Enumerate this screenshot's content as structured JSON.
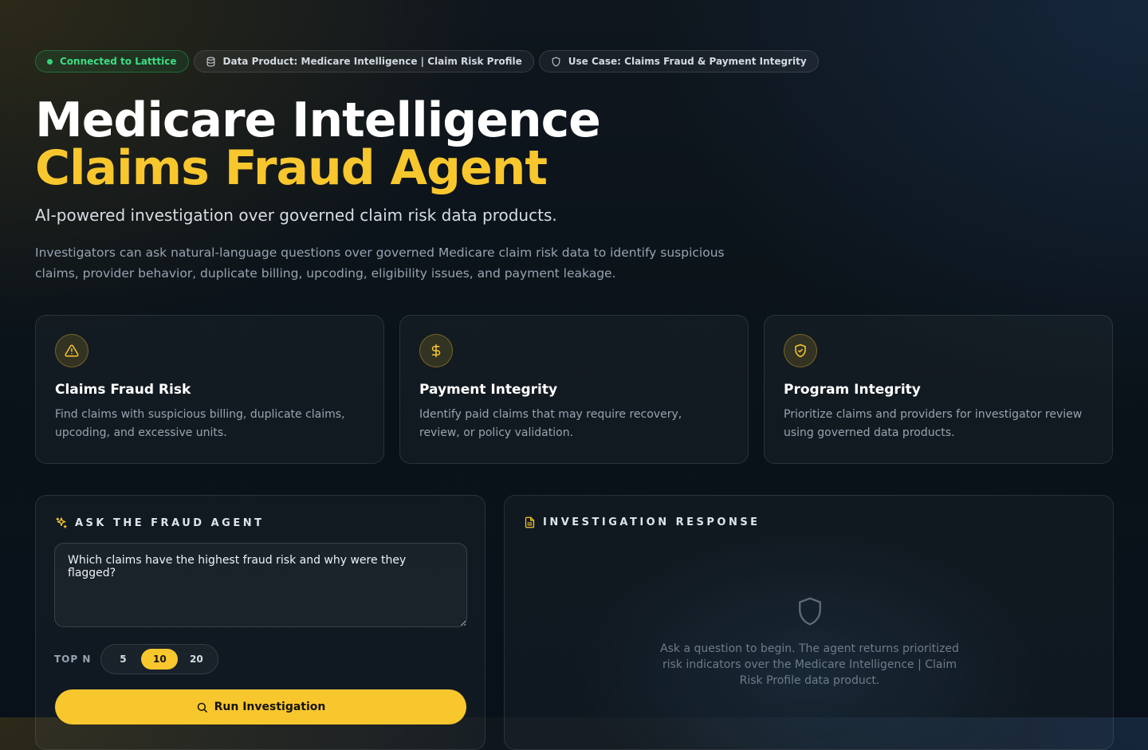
{
  "badges": {
    "connection": "Connected to Latttice",
    "data_product": "Data Product: Medicare Intelligence | Claim Risk Profile",
    "use_case": "Use Case: Claims Fraud & Payment Integrity"
  },
  "hero": {
    "title_line1": "Medicare Intelligence",
    "title_line2": "Claims Fraud Agent",
    "subtitle": "AI-powered investigation over governed claim risk data products.",
    "description": "Investigators can ask natural-language questions over governed Medicare claim risk data to identify suspicious claims, provider behavior, duplicate billing, upcoding, eligibility issues, and payment leakage."
  },
  "cards": [
    {
      "icon": "warning-triangle-icon",
      "title": "Claims Fraud Risk",
      "description": "Find claims with suspicious billing, duplicate claims, upcoding, and excessive units."
    },
    {
      "icon": "dollar-icon",
      "title": "Payment Integrity",
      "description": "Identify paid claims that may require recovery, review, or policy validation."
    },
    {
      "icon": "shield-check-icon",
      "title": "Program Integrity",
      "description": "Prioritize claims and providers for investigator review using governed data products."
    }
  ],
  "ask_panel": {
    "title": "ASK THE FRAUD AGENT",
    "question_value": "Which claims have the highest fraud risk and why were they flagged?",
    "top_n_label": "TOP N",
    "top_n_options": [
      "5",
      "10",
      "20"
    ],
    "top_n_selected": "10",
    "run_label": "Run Investigation"
  },
  "response_panel": {
    "title": "INVESTIGATION RESPONSE",
    "empty_text": "Ask a question to begin. The agent returns prioritized risk indicators over the Medicare Intelligence | Claim Risk Profile data product."
  },
  "colors": {
    "accent": "#f8c72e",
    "connected": "#3ddc84",
    "background": "#0a1219"
  }
}
